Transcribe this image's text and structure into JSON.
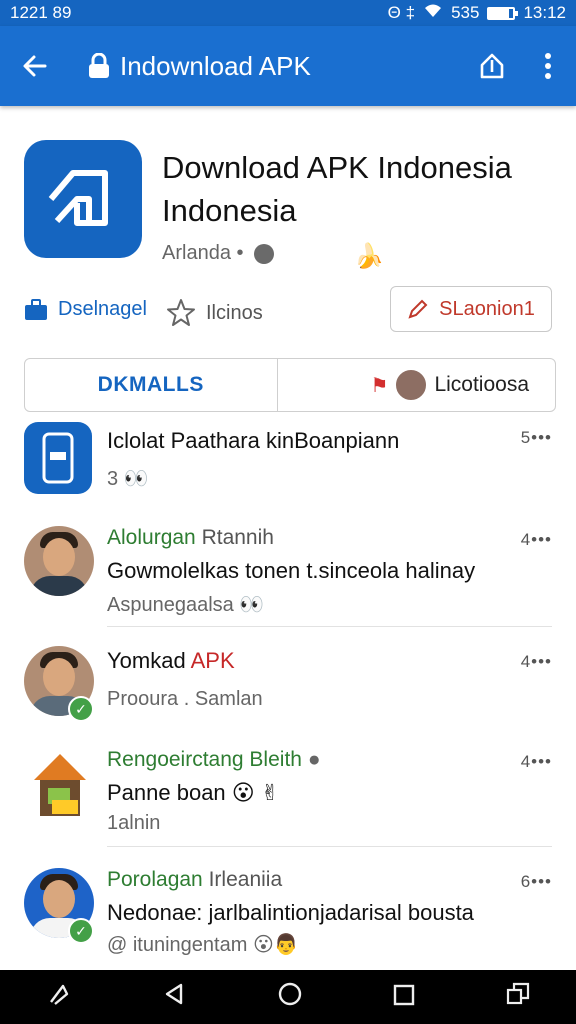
{
  "status": {
    "time": "1221 89",
    "icons_text": "Θ ‡",
    "net": "535",
    "clock_right": "13:12",
    "battery": "80%"
  },
  "appbar": {
    "title": "Indownload APK"
  },
  "app": {
    "title": "Download APK Indonesia Indonesia",
    "developer": "Arlanda •",
    "banana": "🍌"
  },
  "actions": {
    "download": "Dselnagel",
    "likes": "Ilcinos",
    "report": "SLaonion1"
  },
  "tabs": {
    "first": "DKMALLS",
    "second": "Licotioosa"
  },
  "feed": [
    {
      "name": "Iclolat Paathara kinBoanpiann",
      "sub": "3 👀",
      "count": "5•••"
    },
    {
      "name_green": "Alolurgan",
      "name_muted": "Rtannih",
      "text": "Gowmolelkas tonen t.sinceola halinay",
      "sub": "Aspunegaalsa 👀",
      "count": "4•••"
    },
    {
      "name": "Yomkad",
      "name_red": "APK",
      "sub": "Prooura . Samlan",
      "count": "4•••"
    },
    {
      "name_green": "Rengoeirctang Bleith",
      "text": "Panne boan 😮 ✌",
      "sub": "1alnin",
      "count": "4•••"
    },
    {
      "name_green": "Porolagan",
      "name_muted": "Irleaniia",
      "text": "Nedonae: jarlbalintionjadarisal bousta",
      "sub": "@ ituningentam 😮👨",
      "count": "6•••"
    }
  ],
  "colors": {
    "primary": "#1a6fd0",
    "accent_green": "#2e7d32",
    "report_red": "#c0392b"
  }
}
